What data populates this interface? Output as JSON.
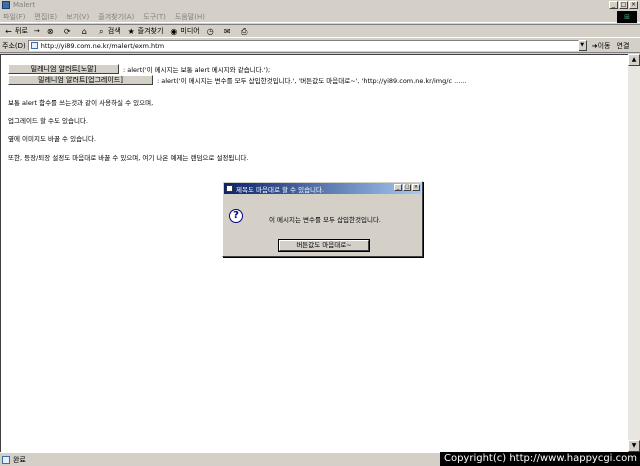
{
  "window": {
    "title": "Malert",
    "minimize": "_",
    "maximize": "□",
    "close": "×"
  },
  "menubar": {
    "items": [
      "파일(F)",
      "편집(E)",
      "보기(V)",
      "즐겨찾기(A)",
      "도구(T)",
      "도움말(H)"
    ]
  },
  "toolbar": {
    "back_label": "뒤로",
    "forward_label": "→",
    "search_label": "검색",
    "favorites_label": "즐겨찾기",
    "media_label": "미디어"
  },
  "address": {
    "label": "주소(D)",
    "url": "http://yi89.com.ne.kr/malert/exm.htm",
    "go_label": "이동",
    "links_label": "연결"
  },
  "content": {
    "button1_label": "밀레니엄 알러트[노말]",
    "code1": ": alert('이 메시지는 보통 alert 메시지와 같습니다.');",
    "button2_label": "밀레니엄 알러트[업그레이드]",
    "code2": ": alert('이 메시지는 변수를 모두 삽입한것입니다.', '버튼값도 마음대로~', 'http://yi89.com.ne.kr/img/c ......",
    "paragraphs": [
      "보통 alert 함수를 쓰는것과 같이 사용하실 수 있으며,",
      "업그레이드 할 수도 있습니다.",
      "옆에 이미지도 바꿀 수 있습니다.",
      "또한, 등장/퇴장 설정도 마음대로 바꿀 수 있으며, 여기 나온 예제는 랜덤으로 설정됩니다."
    ]
  },
  "dialog": {
    "title": "제목도 마음대로 할 수 있습니다.",
    "message": "이 메시지는 변수를 모두 삽입한것입니다.",
    "button_label": "버튼값도 마음대로~",
    "icon": "question-icon"
  },
  "statusbar": {
    "text": "완료"
  },
  "watermark": "Copyright(c) http://www.happycgi.com"
}
